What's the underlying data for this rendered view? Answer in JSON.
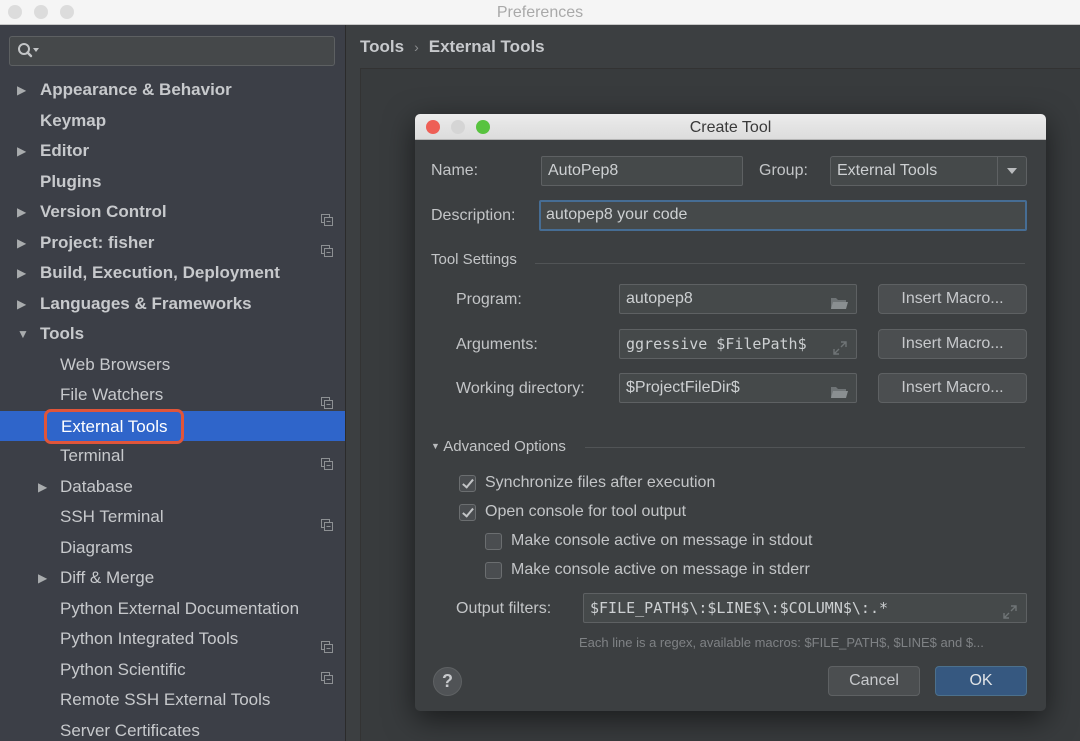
{
  "window": {
    "title": "Preferences"
  },
  "search": {
    "placeholder": "",
    "value": ""
  },
  "sidebar": {
    "items": [
      {
        "label": "Appearance & Behavior",
        "level": 0,
        "arrow": "right",
        "copy": false
      },
      {
        "label": "Keymap",
        "level": 0,
        "arrow": "none",
        "copy": false
      },
      {
        "label": "Editor",
        "level": 0,
        "arrow": "right",
        "copy": false
      },
      {
        "label": "Plugins",
        "level": 0,
        "arrow": "none",
        "copy": false
      },
      {
        "label": "Version Control",
        "level": 0,
        "arrow": "right",
        "copy": true
      },
      {
        "label": "Project: fisher",
        "level": 0,
        "arrow": "right",
        "copy": true
      },
      {
        "label": "Build, Execution, Deployment",
        "level": 0,
        "arrow": "right",
        "copy": false
      },
      {
        "label": "Languages & Frameworks",
        "level": 0,
        "arrow": "right",
        "copy": false
      },
      {
        "label": "Tools",
        "level": 0,
        "arrow": "down",
        "copy": false
      },
      {
        "label": "Web Browsers",
        "level": 1,
        "arrow": "none",
        "copy": false
      },
      {
        "label": "File Watchers",
        "level": 1,
        "arrow": "none",
        "copy": true
      },
      {
        "label": "External Tools",
        "level": 1,
        "arrow": "none",
        "copy": false,
        "selected": true
      },
      {
        "label": "Terminal",
        "level": 1,
        "arrow": "none",
        "copy": true
      },
      {
        "label": "Database",
        "level": 1,
        "arrow": "right",
        "copy": false
      },
      {
        "label": "SSH Terminal",
        "level": 1,
        "arrow": "none",
        "copy": true
      },
      {
        "label": "Diagrams",
        "level": 1,
        "arrow": "none",
        "copy": false
      },
      {
        "label": "Diff & Merge",
        "level": 1,
        "arrow": "right",
        "copy": false
      },
      {
        "label": "Python External Documentation",
        "level": 1,
        "arrow": "none",
        "copy": false
      },
      {
        "label": "Python Integrated Tools",
        "level": 1,
        "arrow": "none",
        "copy": true
      },
      {
        "label": "Python Scientific",
        "level": 1,
        "arrow": "none",
        "copy": true
      },
      {
        "label": "Remote SSH External Tools",
        "level": 1,
        "arrow": "none",
        "copy": false
      },
      {
        "label": "Server Certificates",
        "level": 1,
        "arrow": "none",
        "copy": false
      }
    ]
  },
  "breadcrumb": {
    "parent": "Tools",
    "separator": "›",
    "current": "External Tools"
  },
  "dialog": {
    "title": "Create Tool",
    "name_label": "Name:",
    "name_value": "AutoPep8",
    "group_label": "Group:",
    "group_value": "External Tools",
    "description_label": "Description:",
    "description_value": "autopep8 your code",
    "tool_settings_label": "Tool Settings",
    "program_label": "Program:",
    "program_value": "autopep8",
    "arguments_label": "Arguments:",
    "arguments_value": "ggressive $FilePath$",
    "working_dir_label": "Working directory:",
    "working_dir_value": "$ProjectFileDir$",
    "insert_macro_label": "Insert Macro...",
    "advanced_label": "Advanced Options",
    "checkboxes": [
      {
        "label": "Synchronize files after execution",
        "checked": true
      },
      {
        "label": "Open console for tool output",
        "checked": true
      },
      {
        "label": "Make console active on message in stdout",
        "checked": false
      },
      {
        "label": "Make console active on message in stderr",
        "checked": false
      }
    ],
    "output_filters_label": "Output filters:",
    "output_filters_value": "$FILE_PATH$\\:$LINE$\\:$COLUMN$\\:.*",
    "output_filters_hint": "Each line is a regex, available macros: $FILE_PATH$, $LINE$ and $...",
    "help_label": "?",
    "cancel_label": "Cancel",
    "ok_label": "OK"
  },
  "colors": {
    "selection": "#2f65ca",
    "highlight_outline": "#e0553a",
    "primary_button": "#365880",
    "focus_border": "#466d94",
    "close_light": "#ee5f56",
    "minimize_light": "#d5d5d5",
    "zoom_light": "#58c33f"
  }
}
